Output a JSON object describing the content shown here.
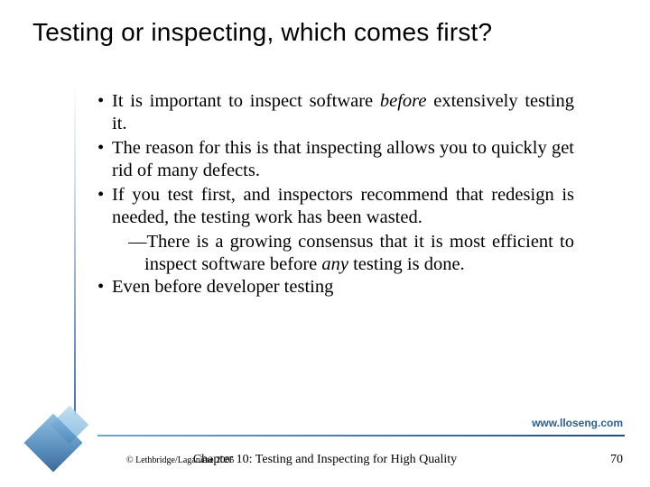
{
  "title": "Testing or inspecting, which comes first?",
  "bullets": [
    {
      "pre": "It is important to inspect software ",
      "em": "before",
      "post": " extensively testing it."
    },
    {
      "text": "The reason for this is that inspecting allows you to quickly get rid of many defects."
    },
    {
      "text": "If you test first, and inspectors recommend that redesign is needed, the testing work has been wasted."
    },
    {
      "sub_pre": "—There is a growing consensus that it is most efficient to inspect software before ",
      "sub_em": "any",
      "sub_post": " testing is done."
    },
    {
      "text": "Even before developer testing"
    }
  ],
  "footer": {
    "url": "www.lloseng.com",
    "copyright": "© Lethbridge/Laganière 2005",
    "chapter": "Chapter 10: Testing and Inspecting for High Quality",
    "page": "70"
  }
}
